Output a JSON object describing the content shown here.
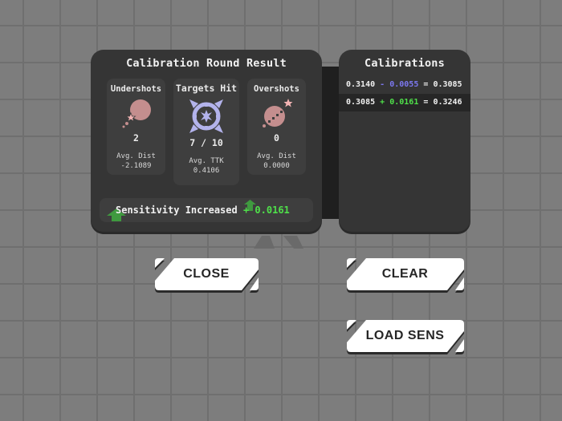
{
  "result_panel": {
    "title": "Calibration Round Result",
    "undershots": {
      "label": "Undershots",
      "icon": "undershot-icon",
      "count": "2",
      "sub_label": "Avg. Dist",
      "sub_value": "-2.1089"
    },
    "targets_hit": {
      "label": "Targets Hit",
      "icon": "crosshair-target-icon",
      "count": "7 / 10",
      "sub_label": "Avg. TTK",
      "sub_value": "0.4106"
    },
    "overshots": {
      "label": "Overshots",
      "icon": "overshot-icon",
      "count": "0",
      "sub_label": "Avg. Dist",
      "sub_value": "0.0000"
    },
    "sensitivity": {
      "text": "Sensitivity Increased",
      "sign": "+",
      "value": "0.0161",
      "icon": "arrow-up-icon",
      "color": "#4fe04a"
    }
  },
  "calibrations_panel": {
    "title": "Calibrations",
    "rows": [
      {
        "base": "0.3140",
        "op": "-",
        "delta": "0.0055",
        "eq": "=",
        "result": "0.3085",
        "delta_color": "#7c78f0"
      },
      {
        "base": "0.3085",
        "op": "+",
        "delta": "0.0161",
        "eq": "=",
        "result": "0.3246",
        "delta_color": "#4fe04a"
      }
    ]
  },
  "buttons": {
    "close": "CLOSE",
    "clear": "CLEAR",
    "load_sens": "LOAD SENS"
  },
  "colors": {
    "panel": "#353535",
    "card": "#3e3e3e",
    "icon_pink": "#c48e8e",
    "icon_star": "#f3b4b4",
    "icon_target": "#b3b3ec",
    "positive": "#4fe04a",
    "negative": "#7c78f0"
  }
}
